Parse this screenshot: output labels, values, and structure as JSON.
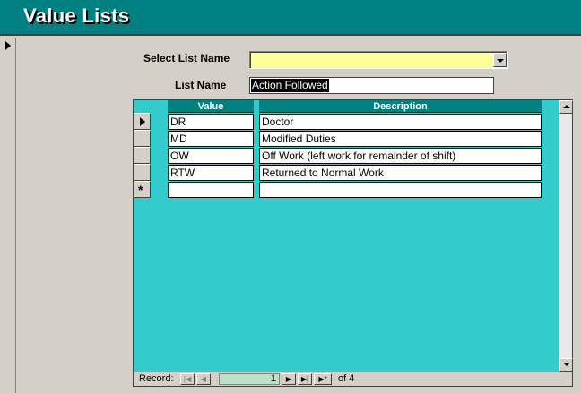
{
  "form": {
    "title": "Value Lists",
    "select_list_label": "Select List Name",
    "select_list_value": "",
    "list_name_label": "List Name",
    "list_name_value": "Action Followed"
  },
  "grid": {
    "columns": [
      "Value",
      "Description"
    ],
    "rows": [
      {
        "value": "DR",
        "description": "Doctor",
        "current": true
      },
      {
        "value": "MD",
        "description": "Modified Duties",
        "current": false
      },
      {
        "value": "OW",
        "description": "Off Work (left work for remainder of shift)",
        "current": false
      },
      {
        "value": "RTW",
        "description": "Returned to Normal Work",
        "current": false
      }
    ],
    "new_row_marker": "*"
  },
  "navigation": {
    "record_label": "Record:",
    "current_record": "1",
    "of_label": "of",
    "total_records": "4",
    "buttons": [
      "first-record",
      "previous-record",
      "next-record",
      "last-record",
      "new-record"
    ]
  },
  "colors": {
    "header_bg": "#008080",
    "grid_bg": "#33cccc",
    "combo_bg": "#ffff99"
  }
}
